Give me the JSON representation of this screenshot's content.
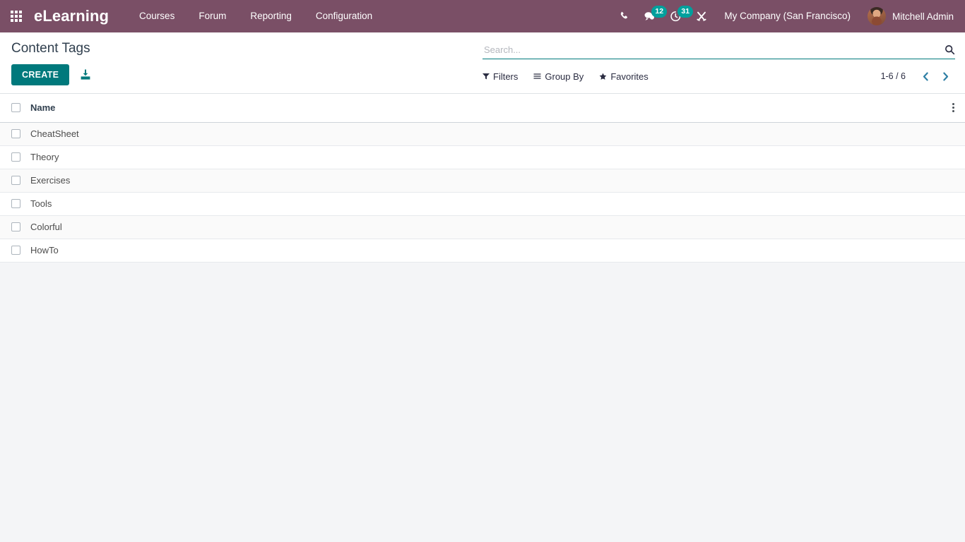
{
  "navbar": {
    "apps_icon": "apps-grid-icon",
    "brand": "eLearning",
    "menu": [
      {
        "label": "Courses"
      },
      {
        "label": "Forum"
      },
      {
        "label": "Reporting"
      },
      {
        "label": "Configuration"
      }
    ],
    "icons": [
      {
        "name": "phone-icon",
        "badge": null
      },
      {
        "name": "messages-icon",
        "badge": "12"
      },
      {
        "name": "activities-clock-icon",
        "badge": "31"
      },
      {
        "name": "developer-tools-icon",
        "badge": null
      }
    ],
    "company": "My Company (San Francisco)",
    "user": "Mitchell Admin",
    "avatar_icon": "user-avatar"
  },
  "control_panel": {
    "title": "Content Tags",
    "create_label": "CREATE",
    "import_icon": "import-records-icon",
    "search": {
      "placeholder": "Search...",
      "value": "",
      "search_icon": "search-icon"
    },
    "filters_label": "Filters",
    "group_by_label": "Group By",
    "favorites_label": "Favorites",
    "pager": {
      "value": "1-6 / 6",
      "previous_icon": "chevron-left-icon",
      "next_icon": "chevron-right-icon"
    }
  },
  "list": {
    "columns": [
      "Name"
    ],
    "optional_columns_icon": "vertical-ellipsis-icon",
    "rows": [
      {
        "name": "CheatSheet"
      },
      {
        "name": "Theory"
      },
      {
        "name": "Exercises"
      },
      {
        "name": "Tools"
      },
      {
        "name": "Colorful"
      },
      {
        "name": "HowTo"
      }
    ]
  },
  "colors": {
    "navbar_bg": "#7A4F66",
    "accent_teal": "#00797C",
    "badge_teal": "#00A09D",
    "pager_chevron": "#2E7FA5",
    "page_bg": "#F4F5F7"
  }
}
